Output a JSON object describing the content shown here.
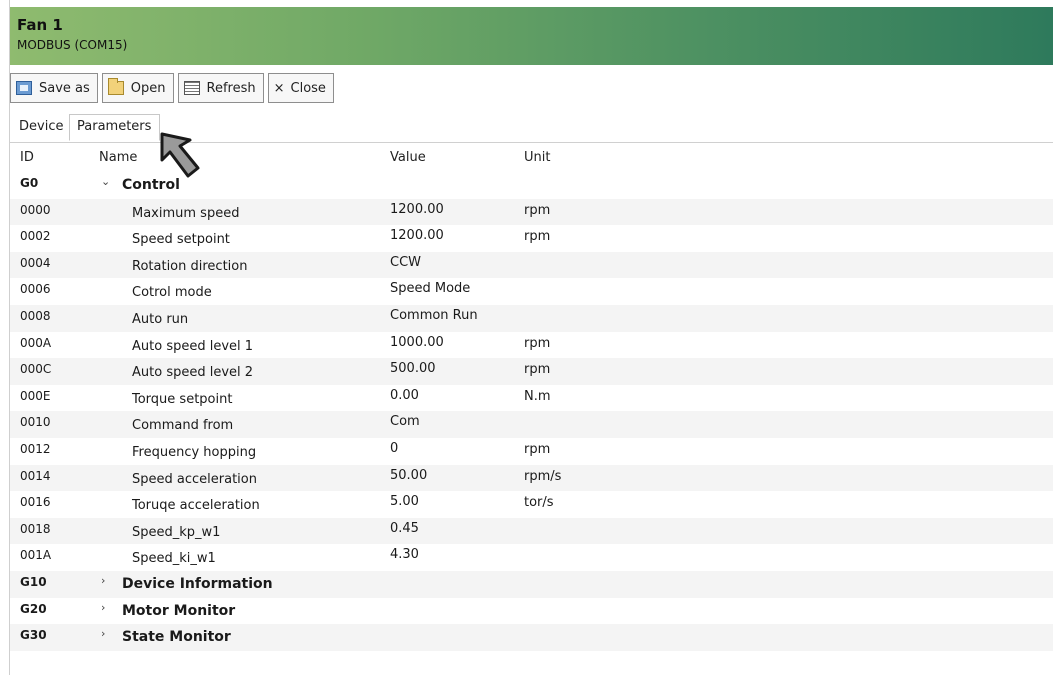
{
  "window": {
    "title": "Fan 1",
    "subtitle": "MODBUS (COM15)"
  },
  "toolbar": {
    "save_as": "Save as",
    "open": "Open",
    "refresh": "Refresh",
    "close_glyph": "×",
    "close": "Close"
  },
  "tabs": [
    "Device",
    "Parameters"
  ],
  "active_tab": "Parameters",
  "columns": {
    "id": "ID",
    "name": "Name",
    "value": "Value",
    "unit": "Unit"
  },
  "groups": [
    {
      "id": "G0",
      "name": "Control",
      "expanded": true,
      "chevron": "⌄"
    },
    {
      "id": "G10",
      "name": "Device Information",
      "expanded": false,
      "chevron": "›"
    },
    {
      "id": "G20",
      "name": "Motor Monitor",
      "expanded": false,
      "chevron": "›"
    },
    {
      "id": "G30",
      "name": "State Monitor",
      "expanded": false,
      "chevron": "›"
    }
  ],
  "params": [
    {
      "id": "0000",
      "name": "Maximum speed",
      "value": "1200.00",
      "unit": "rpm"
    },
    {
      "id": "0002",
      "name": "Speed setpoint",
      "value": "1200.00",
      "unit": "rpm"
    },
    {
      "id": "0004",
      "name": "Rotation direction",
      "value": "CCW",
      "unit": ""
    },
    {
      "id": "0006",
      "name": "Cotrol mode",
      "value": "Speed Mode",
      "unit": ""
    },
    {
      "id": "0008",
      "name": "Auto run",
      "value": "Common Run",
      "unit": ""
    },
    {
      "id": "000A",
      "name": "Auto speed level 1",
      "value": "1000.00",
      "unit": "rpm"
    },
    {
      "id": "000C",
      "name": "Auto speed level 2",
      "value": "500.00",
      "unit": "rpm"
    },
    {
      "id": "000E",
      "name": "Torque setpoint",
      "value": "0.00",
      "unit": "N.m"
    },
    {
      "id": "0010",
      "name": "Command from",
      "value": "Com",
      "unit": ""
    },
    {
      "id": "0012",
      "name": "Frequency hopping",
      "value": "0",
      "unit": "rpm"
    },
    {
      "id": "0014",
      "name": "Speed acceleration",
      "value": "50.00",
      "unit": "rpm/s"
    },
    {
      "id": "0016",
      "name": "Toruqe acceleration",
      "value": "5.00",
      "unit": "tor/s"
    },
    {
      "id": "0018",
      "name": "Speed_kp_w1",
      "value": "0.45",
      "unit": ""
    },
    {
      "id": "001A",
      "name": "Speed_ki_w1",
      "value": "4.30",
      "unit": ""
    }
  ],
  "colors": {
    "header_start": "#8fbb6f",
    "header_end": "#2e7a5c",
    "row_stripe": "#f4f4f4"
  }
}
